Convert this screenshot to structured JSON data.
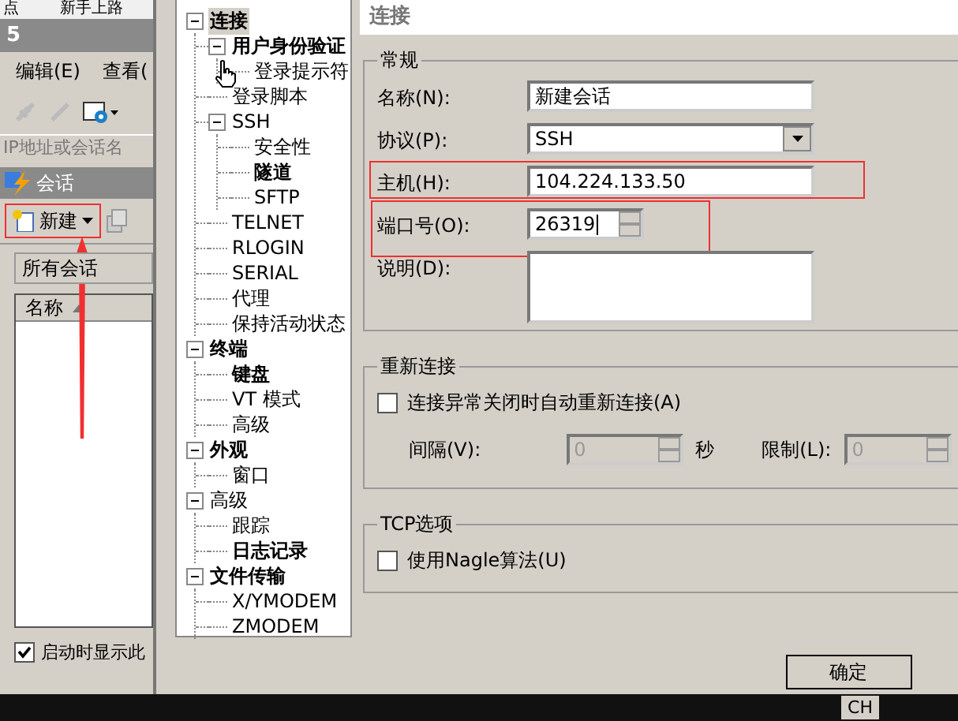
{
  "background_app": {
    "top_strip": [
      "点",
      "新手上路"
    ],
    "title": "5",
    "menu": [
      "编辑(E)",
      "查看("
    ],
    "address_placeholder": "IP地址或会话名",
    "sessions": {
      "title": "会话",
      "new_button": {
        "label": "新建",
        "highlighted": true
      },
      "folder": "所有会话",
      "column": "名称",
      "show_on_startup": {
        "label": "启动时显示此",
        "checked": true
      }
    }
  },
  "dialog": {
    "tree": [
      {
        "label": "连接",
        "bold": true,
        "selected": true,
        "expanded": true,
        "children": [
          {
            "label": "用户身份验证",
            "bold": true,
            "selected": false,
            "expanded": true,
            "children": [
              {
                "label": "登录提示符",
                "bold": false,
                "selected": false
              }
            ]
          },
          {
            "label": "登录脚本",
            "bold": false,
            "selected": false
          },
          {
            "label": "SSH",
            "bold": false,
            "selected": false,
            "expanded": true,
            "children": [
              {
                "label": "安全性",
                "bold": false,
                "selected": false
              },
              {
                "label": "隧道",
                "bold": true,
                "selected": false
              },
              {
                "label": "SFTP",
                "bold": false,
                "selected": false
              }
            ]
          },
          {
            "label": "TELNET",
            "bold": false,
            "selected": false
          },
          {
            "label": "RLOGIN",
            "bold": false,
            "selected": false
          },
          {
            "label": "SERIAL",
            "bold": false,
            "selected": false
          },
          {
            "label": "代理",
            "bold": false,
            "selected": false
          },
          {
            "label": "保持活动状态",
            "bold": false,
            "selected": false
          }
        ]
      },
      {
        "label": "终端",
        "bold": true,
        "selected": false,
        "expanded": true,
        "children": [
          {
            "label": "键盘",
            "bold": true,
            "selected": false
          },
          {
            "label": "VT 模式",
            "bold": false,
            "selected": false
          },
          {
            "label": "高级",
            "bold": false,
            "selected": false
          }
        ]
      },
      {
        "label": "外观",
        "bold": true,
        "selected": false,
        "expanded": true,
        "children": [
          {
            "label": "窗口",
            "bold": false,
            "selected": false
          }
        ]
      },
      {
        "label": "高级",
        "bold": false,
        "selected": false,
        "expanded": true,
        "children": [
          {
            "label": "跟踪",
            "bold": false,
            "selected": false
          },
          {
            "label": "日志记录",
            "bold": true,
            "selected": false
          }
        ]
      },
      {
        "label": "文件传输",
        "bold": true,
        "selected": false,
        "expanded": true,
        "children": [
          {
            "label": "X/YMODEM",
            "bold": false,
            "selected": false
          },
          {
            "label": "ZMODEM",
            "bold": false,
            "selected": false
          }
        ]
      }
    ],
    "page_title": "连接",
    "general": {
      "title": "常规",
      "fields": [
        {
          "label": "名称(N):",
          "value": "新建会话",
          "kind": "text",
          "highlighted": false
        },
        {
          "label": "协议(P):",
          "value": "SSH",
          "kind": "combo",
          "highlighted": false
        },
        {
          "label": "主机(H):",
          "value": "104.224.133.50",
          "kind": "text",
          "highlighted": true
        },
        {
          "label": "端口号(O):",
          "value": "26319",
          "kind": "spin",
          "highlighted": true
        },
        {
          "label": "说明(D):",
          "kind": "area",
          "highlighted": false
        }
      ]
    },
    "reconnect": {
      "title": "重新连接",
      "checkbox": {
        "label": "连接异常关闭时自动重新连接(A)",
        "checked": false
      },
      "interval": {
        "label": "间隔(V):",
        "value": "0",
        "unit": "秒",
        "disabled": true
      },
      "limit": {
        "label": "限制(L):",
        "value": "0",
        "disabled": true
      }
    },
    "tcp": {
      "title": "TCP选项",
      "checkbox": {
        "label": "使用Nagle算法(U)",
        "checked": false
      }
    },
    "buttons": [
      "确定"
    ]
  },
  "taskbar": {
    "language": "CH"
  }
}
